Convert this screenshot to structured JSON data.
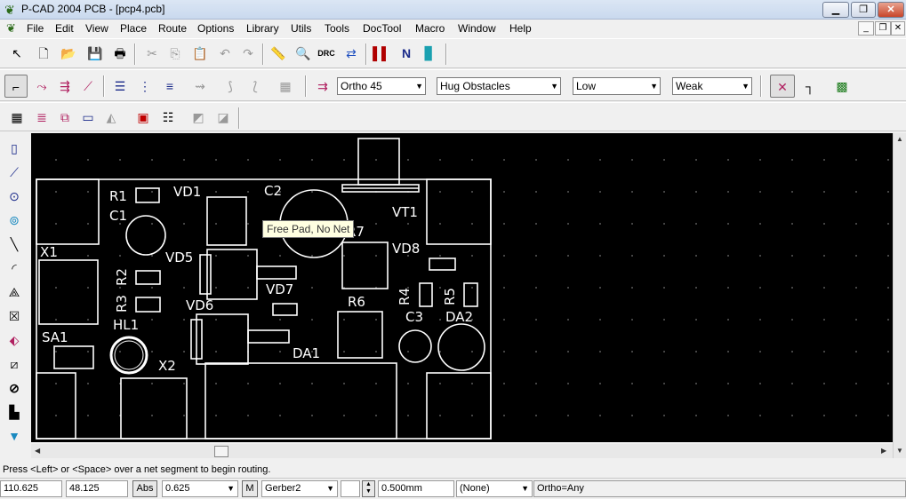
{
  "window": {
    "title": "P-CAD 2004 PCB - [pcp4.pcb]"
  },
  "menu": [
    "File",
    "Edit",
    "View",
    "Place",
    "Route",
    "Options",
    "Library",
    "Utils",
    "Tools",
    "DocTool",
    "Macro",
    "Window",
    "Help"
  ],
  "route_toolbar": {
    "mode_dropdown": "Ortho 45",
    "obstacle_dropdown": "Hug Obstacles",
    "level_dropdown": "Low",
    "strength_dropdown": "Weak"
  },
  "pcb": {
    "designators": [
      "R1",
      "VD1",
      "C2",
      "C1",
      "VT1",
      "X1",
      "R7",
      "VD5",
      "VD8",
      "R2",
      "VD7",
      "R4",
      "R5",
      "R3",
      "VD6",
      "R6",
      "C3",
      "DA2",
      "HL1",
      "SA1",
      "DA1",
      "X2"
    ]
  },
  "tooltip": "Free Pad, No Net",
  "status": {
    "message": "Press <Left> or <Space> over a net segment to begin routing."
  },
  "bottombar": {
    "x": "110.625",
    "y": "48.125",
    "abs_label": "Abs",
    "grid": "0.625",
    "m_label": "M",
    "layer": "Gerber2",
    "width": "0.500mm",
    "net": "(None)",
    "mode": "Ortho=Any"
  },
  "colors": {
    "canvas": "#000000",
    "silkscreen": "#ffffff",
    "grid_dot": "#5a5a5a"
  }
}
